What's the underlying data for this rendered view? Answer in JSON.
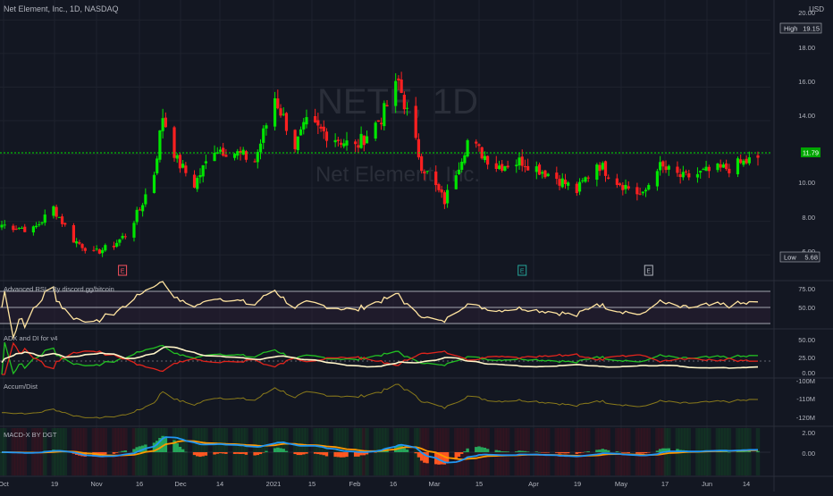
{
  "header": {
    "title": "Net Element, Inc., 1D, NASDAQ",
    "currency": "USD"
  },
  "watermark": {
    "symbol": "NETE, 1D",
    "name": "Net Element, Inc."
  },
  "price_pane": {
    "ticks": [
      "20.00",
      "18.00",
      "16.00",
      "14.00",
      "12.00",
      "10.00",
      "8.00",
      "6.00"
    ],
    "current_price": "11.79",
    "high_label": "High",
    "high_value": "19.15",
    "low_label": "Low",
    "low_value": "5.68"
  },
  "earnings_markers": [
    {
      "date": "2020-11-12",
      "label": "E",
      "color": "#f7525f"
    },
    {
      "date": "2021-03-31",
      "label": "E",
      "color": "#26a69a"
    },
    {
      "date": "2021-05-14",
      "label": "E",
      "color": "#b2b5be"
    }
  ],
  "indicators": {
    "rsi": {
      "title": "Advanced RSI - By discord.gg/bitcoin",
      "ticks": [
        "75.00",
        "50.00"
      ]
    },
    "adx": {
      "title": "ADX and DI for v4",
      "ticks": [
        "50.00",
        "25.00",
        "0.00"
      ]
    },
    "accum": {
      "title": "Accum/Dist",
      "ticks": [
        "-100M",
        "-110M",
        "-120M"
      ]
    },
    "macd": {
      "title": "MACD-X BY DGT",
      "ticks": [
        "2.00",
        "0.00"
      ]
    }
  },
  "xaxis": [
    "Oct",
    "19",
    "Nov",
    "16",
    "Dec",
    "14",
    "2021",
    "15",
    "Feb",
    "16",
    "Mar",
    "15",
    "Apr",
    "19",
    "May",
    "17",
    "Jun",
    "14"
  ],
  "colors": {
    "up": "#00e600",
    "down": "#ff2020",
    "background": "#131722",
    "rsi_line": "#ffe4a0",
    "adx_line": "#fff5c8",
    "di_plus": "#22c022",
    "di_minus": "#e0241c",
    "accum_line": "#8a7a1a",
    "macd_line": "#2196f3",
    "signal_line": "#ff9800"
  },
  "chart_data": {
    "type": "candlestick",
    "title": "Net Element, Inc., 1D, NASDAQ",
    "ylim": [
      5,
      20.5
    ],
    "x_range": [
      "2020-10-01",
      "2021-06-21"
    ],
    "series": [
      {
        "name": "NETE",
        "points": [
          [
            "2020-10-01",
            7.8
          ],
          [
            "2020-10-12",
            7.5
          ],
          [
            "2020-10-19",
            8.8
          ],
          [
            "2020-10-26",
            6.9
          ],
          [
            "2020-11-02",
            6.1
          ],
          [
            "2020-11-09",
            6.6
          ],
          [
            "2020-11-13",
            7.2
          ],
          [
            "2020-11-18",
            8.7
          ],
          [
            "2020-11-23",
            10.9
          ],
          [
            "2020-11-26",
            14.3
          ],
          [
            "2020-12-01",
            11.6
          ],
          [
            "2020-12-07",
            10.2
          ],
          [
            "2020-12-14",
            12.4
          ],
          [
            "2020-12-21",
            12.1
          ],
          [
            "2020-12-28",
            11.6
          ],
          [
            "2021-01-04",
            15.4
          ],
          [
            "2021-01-11",
            12.5
          ],
          [
            "2021-01-15",
            13.8
          ],
          [
            "2021-01-25",
            13.0
          ],
          [
            "2021-02-01",
            12.4
          ],
          [
            "2021-02-10",
            14.2
          ],
          [
            "2021-02-16",
            16.3
          ],
          [
            "2021-02-24",
            11.4
          ],
          [
            "2021-03-04",
            9.2
          ],
          [
            "2021-03-12",
            12.8
          ],
          [
            "2021-03-22",
            11.3
          ],
          [
            "2021-03-31",
            11.6
          ],
          [
            "2021-04-12",
            10.6
          ],
          [
            "2021-04-19",
            9.8
          ],
          [
            "2021-04-26",
            11.5
          ],
          [
            "2021-05-03",
            10.4
          ],
          [
            "2021-05-12",
            9.5
          ],
          [
            "2021-05-17",
            11.3
          ],
          [
            "2021-05-26",
            10.6
          ],
          [
            "2021-06-02",
            10.9
          ],
          [
            "2021-06-11",
            11.2
          ],
          [
            "2021-06-21",
            11.79
          ]
        ]
      }
    ]
  }
}
